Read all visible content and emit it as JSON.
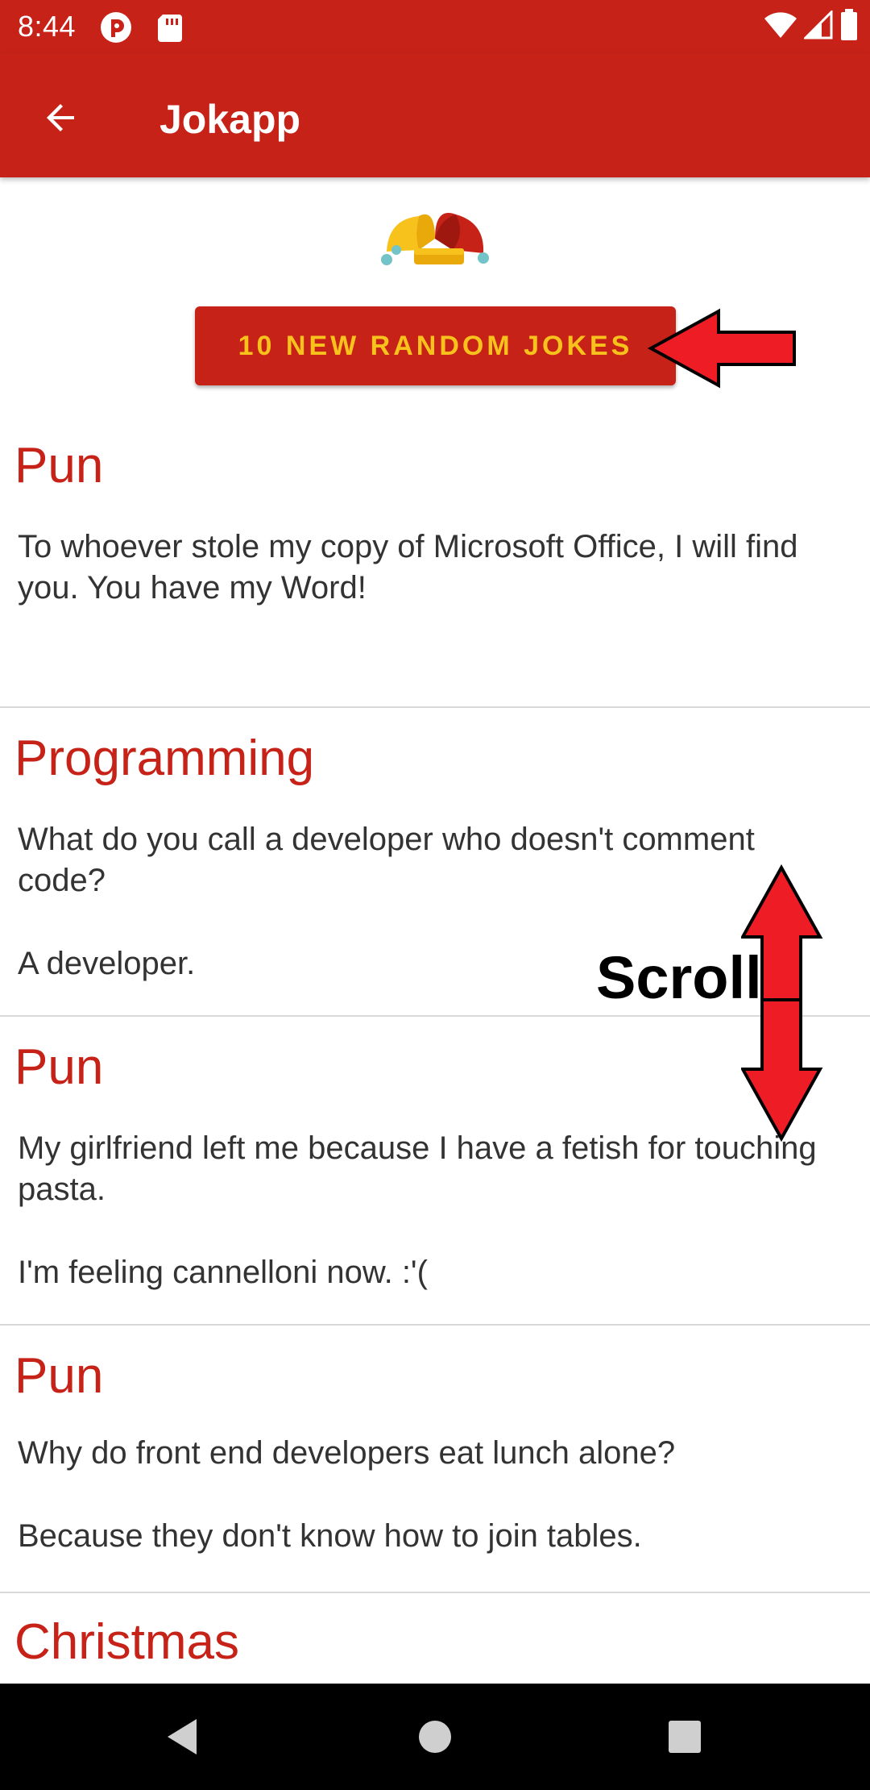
{
  "status_bar": {
    "time": "8:44",
    "icons": [
      "notification-icon",
      "sd-card-icon",
      "wifi-icon",
      "signal-icon",
      "battery-icon"
    ]
  },
  "app_bar": {
    "title": "Jokapp",
    "back_icon": "arrow-back-icon"
  },
  "logo": "jester-hat-logo",
  "new_jokes_button": "10 NEW RANDOM JOKES",
  "jokes": [
    {
      "category": "Pun",
      "lines": [
        "To whoever stole my copy of Microsoft Office, I will find you. You have my Word!"
      ]
    },
    {
      "category": "Programming",
      "lines": [
        "What do you call a developer who doesn't comment code?",
        "A developer."
      ]
    },
    {
      "category": "Pun",
      "lines": [
        "My girlfriend left me because I have a fetish for touching pasta.",
        "I'm feeling cannelloni now. :'("
      ]
    },
    {
      "category": "Pun",
      "lines": [
        "Why do front end developers eat lunch alone?",
        "Because they don't know how to join tables."
      ]
    },
    {
      "category": "Christmas",
      "lines": []
    }
  ],
  "annotation": {
    "scroll_label": "Scroll"
  },
  "nav_bar": {
    "icons": [
      "back-triangle-icon",
      "home-circle-icon",
      "recents-square-icon"
    ]
  },
  "colors": {
    "primary": "#c72218",
    "accent": "#f7c21b",
    "annotation_red": "#ee1c25"
  }
}
